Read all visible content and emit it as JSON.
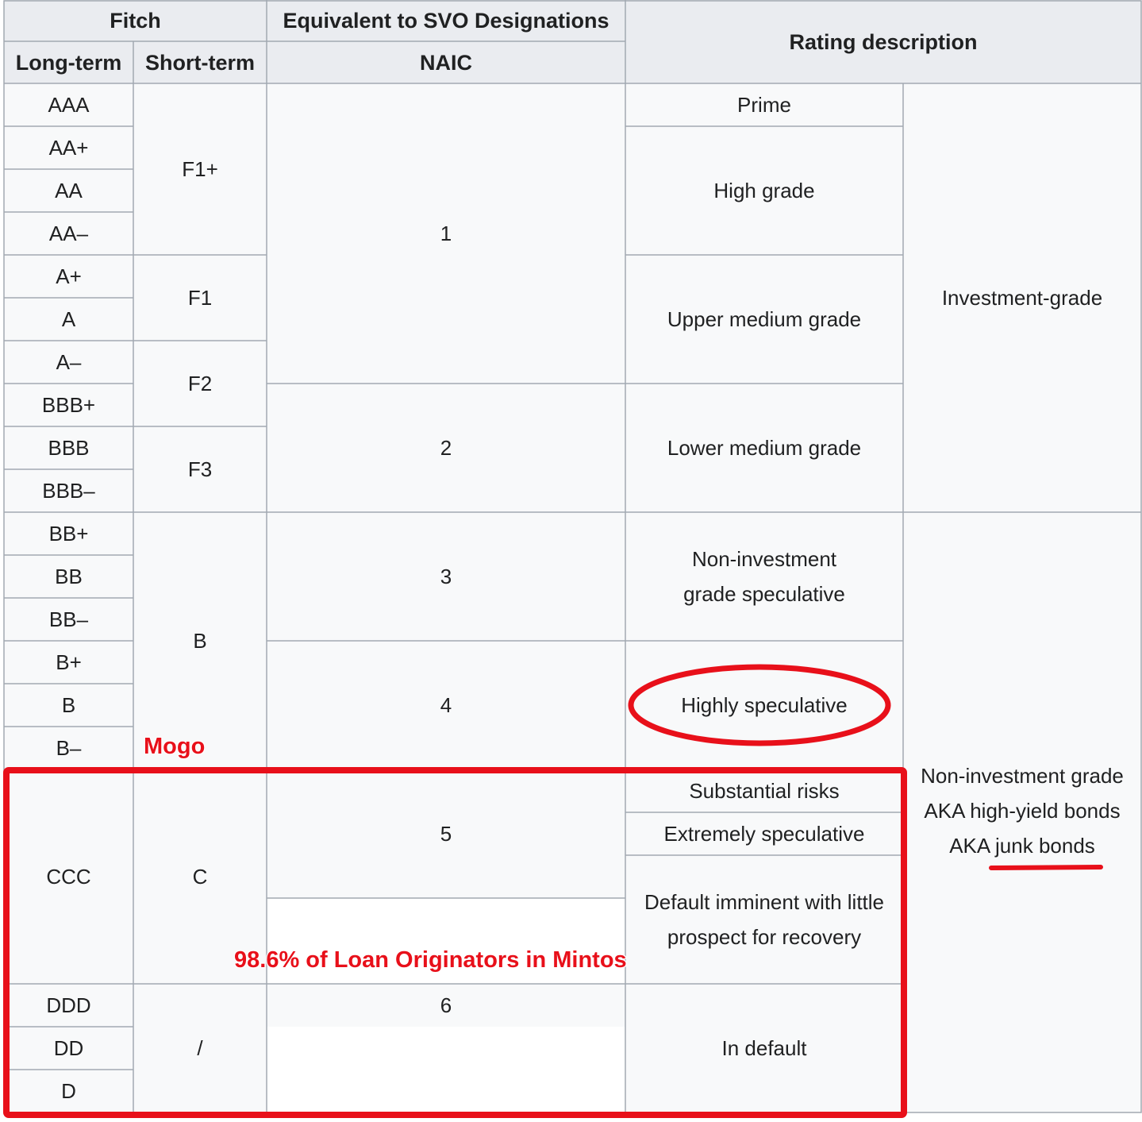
{
  "header": {
    "fitch": "Fitch",
    "svo": "Equivalent to SVO Designations",
    "rating_description": "Rating description",
    "long_term": "Long-term",
    "short_term": "Short-term",
    "naic": "NAIC"
  },
  "long_term": [
    "AAA",
    "AA+",
    "AA",
    "AA–",
    "A+",
    "A",
    "A–",
    "BBB+",
    "BBB",
    "BBB–",
    "BB+",
    "BB",
    "BB–",
    "B+",
    "B",
    "B–",
    "CCC",
    "DDD",
    "DD",
    "D"
  ],
  "short_term": [
    "F1+",
    "F1",
    "F2",
    "F3",
    "B",
    "C",
    "/"
  ],
  "naic": [
    "1",
    "2",
    "3",
    "4",
    "5",
    "6"
  ],
  "descriptions": [
    "Prime",
    "High grade",
    "Upper medium grade",
    "Lower medium grade",
    "Non-investment grade speculative",
    "Highly speculative",
    "Substantial risks",
    "Extremely speculative",
    "Default imminent with little prospect for recovery",
    "In default"
  ],
  "categories": {
    "investment": "Investment-grade",
    "non_investment_line1": "Non-investment grade",
    "non_investment_line2": "AKA high-yield bonds",
    "non_investment_line3_prefix": "AKA ",
    "non_investment_line3_junk": "junk bonds"
  },
  "annotations": {
    "mogo": "Mogo",
    "mintos": "98.6% of Loan Originators in Mintos",
    "color": "#e8101a"
  }
}
